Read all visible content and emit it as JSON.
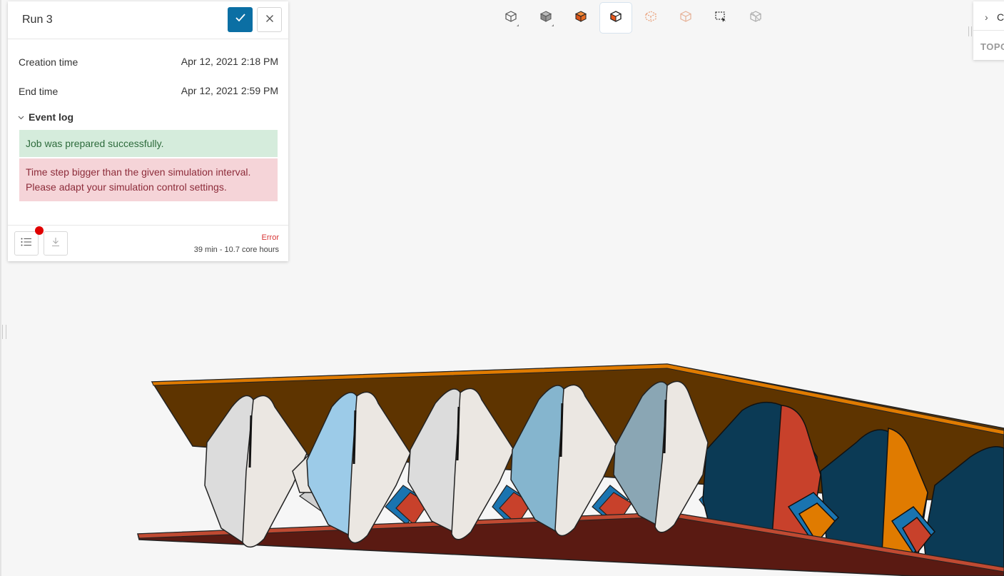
{
  "run_card": {
    "title": "Run 3",
    "properties": [
      {
        "label": "Creation time",
        "value": "Apr 12, 2021 2:18 PM"
      },
      {
        "label": "End time",
        "value": "Apr 12, 2021 2:59 PM"
      }
    ],
    "event_log": {
      "label": "Event log",
      "expanded": true,
      "events": [
        {
          "type": "success",
          "line1": "Job was prepared successfully.",
          "line2": ""
        },
        {
          "type": "error",
          "line1": "Time step bigger than the given simulation interval.",
          "line2": "Please adapt your simulation control settings."
        }
      ]
    },
    "footer": {
      "status": "Error",
      "usage": "39 min - 10.7 core hours"
    }
  },
  "right_panel": {
    "title": "C",
    "section": "TOPO"
  },
  "toolbar": {
    "buttons": [
      {
        "name": "perspective-icon",
        "active": false
      },
      {
        "name": "solid-view-icon",
        "active": false
      },
      {
        "name": "select-body-icon",
        "active": false
      },
      {
        "name": "select-face-icon",
        "active": true
      },
      {
        "name": "select-edge-icon",
        "active": false
      },
      {
        "name": "select-point-icon",
        "active": false
      },
      {
        "name": "box-select-icon",
        "active": false
      },
      {
        "name": "hide-geometry-icon",
        "active": false
      }
    ]
  },
  "colors": {
    "accent": "#0b6fa4",
    "success_bg": "#d5ecdc",
    "error_bg": "#f5d4d8",
    "error_text": "#d83434",
    "top_plate": "#5e3400",
    "bottom_plate": "#5a1a12",
    "channel_dark": "#0b3a55",
    "channel_red": "#c8412b",
    "channel_orange": "#e07b00",
    "channel_blue": "#1a74b0"
  }
}
